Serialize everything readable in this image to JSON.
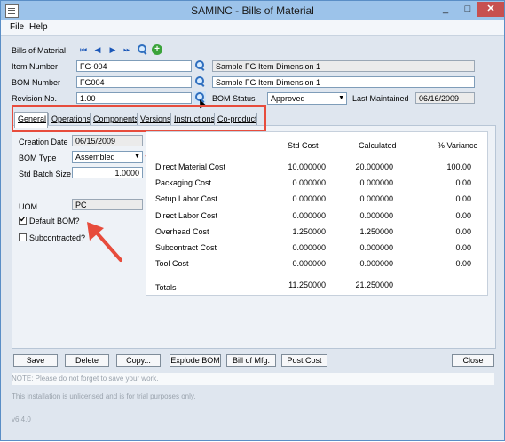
{
  "window": {
    "title": "SAMINC - Bills of Material",
    "min_glyph": "_",
    "max_glyph": "□",
    "close_glyph": "✕"
  },
  "menu": {
    "file": "File",
    "help": "Help"
  },
  "header": {
    "bom_label": "Bills of Material",
    "item_number_label": "Item Number",
    "item_number_value": "FG-004",
    "item_description": "Sample FG Item Dimension 1",
    "bom_number_label": "BOM Number",
    "bom_number_value": "FG004",
    "bom_description": "Sample FG Item Dimension 1",
    "revision_label": "Revision No.",
    "revision_value": "1.00",
    "bom_status_label": "BOM Status",
    "bom_status_value": "Approved",
    "last_maintained_label": "Last Maintained",
    "last_maintained_value": "06/16/2009",
    "nav": {
      "first": "⏮",
      "prev": "◀",
      "next": "▶",
      "last": "⏭",
      "add": "+"
    }
  },
  "tabs": [
    "General",
    "Operations",
    "Components",
    "Versions",
    "Instructions",
    "Co-product"
  ],
  "general": {
    "creation_date_label": "Creation Date",
    "creation_date_value": "06/15/2009",
    "bom_type_label": "BOM Type",
    "bom_type_value": "Assembled",
    "std_batch_label": "Std Batch Size",
    "std_batch_value": "1.0000",
    "uom_label": "UOM",
    "uom_value": "PC",
    "default_bom_label": "Default BOM?",
    "default_bom_checked": true,
    "subcontracted_label": "Subcontracted?",
    "subcontracted_checked": false
  },
  "costs": {
    "headers": {
      "std": "Std Cost",
      "calc": "Calculated",
      "var": "% Variance"
    },
    "rows": [
      {
        "label": "Direct Material Cost",
        "std": "10.000000",
        "calc": "20.000000",
        "var": "100.00"
      },
      {
        "label": "Packaging Cost",
        "std": "0.000000",
        "calc": "0.000000",
        "var": "0.00"
      },
      {
        "label": "Setup Labor Cost",
        "std": "0.000000",
        "calc": "0.000000",
        "var": "0.00"
      },
      {
        "label": "Direct Labor Cost",
        "std": "0.000000",
        "calc": "0.000000",
        "var": "0.00"
      },
      {
        "label": "Overhead Cost",
        "std": "1.250000",
        "calc": "1.250000",
        "var": "0.00"
      },
      {
        "label": "Subcontract Cost",
        "std": "0.000000",
        "calc": "0.000000",
        "var": "0.00"
      },
      {
        "label": "Tool Cost",
        "std": "0.000000",
        "calc": "0.000000",
        "var": "0.00"
      }
    ],
    "totals": {
      "label": "Totals",
      "std": "11.250000",
      "calc": "21.250000"
    }
  },
  "buttons": {
    "save": "Save",
    "delete": "Delete",
    "copy": "Copy...",
    "explode": "Explode BOM",
    "bill_of_mfg": "Bill of Mfg.",
    "post_cost": "Post Cost",
    "close": "Close"
  },
  "footer": {
    "note": "NOTE: Please do not forget to save your work.",
    "license": "This installation is unlicensed and is for trial purposes only.",
    "version": "v6.4.0"
  },
  "colors": {
    "annotation": "#e74c3c",
    "titlebar": "#9cc3ea"
  }
}
